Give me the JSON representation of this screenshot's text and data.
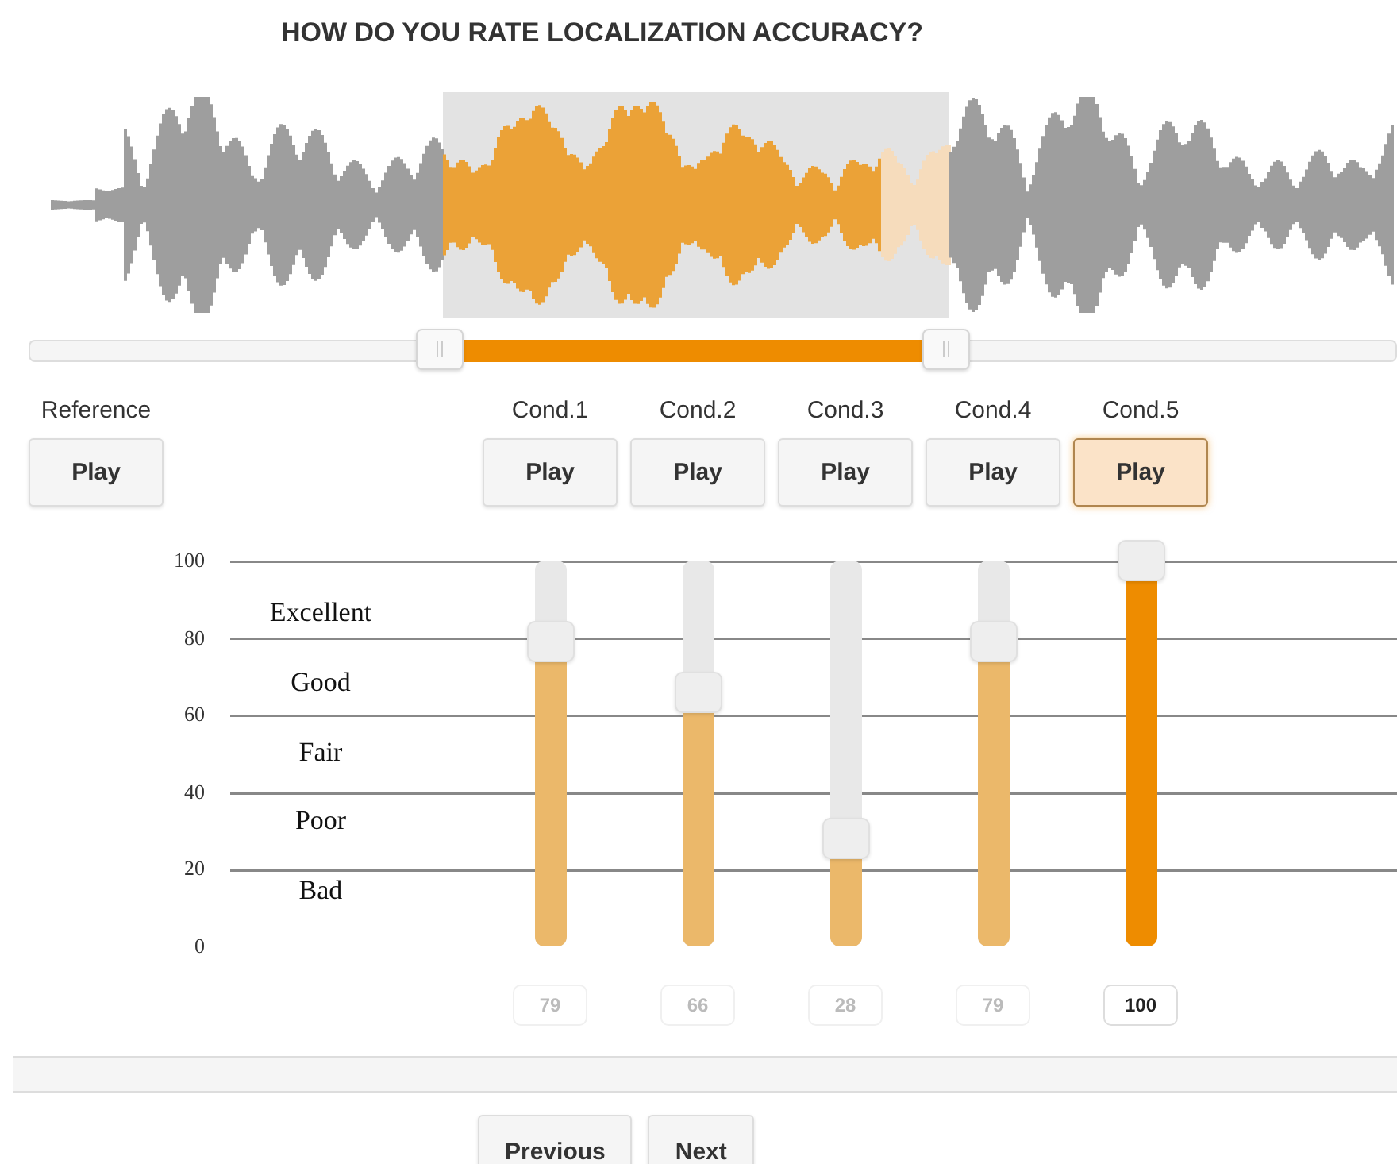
{
  "title": "HOW DO YOU RATE LOCALIZATION ACCURACY?",
  "reference": {
    "label": "Reference",
    "button": "Play"
  },
  "conditions": [
    {
      "label": "Cond.1",
      "button": "Play",
      "selected": false,
      "level": 0.79,
      "value": "79"
    },
    {
      "label": "Cond.2",
      "button": "Play",
      "selected": false,
      "level": 0.66,
      "value": "66"
    },
    {
      "label": "Cond.3",
      "button": "Play",
      "selected": false,
      "level": 0.28,
      "value": "28"
    },
    {
      "label": "Cond.4",
      "button": "Play",
      "selected": false,
      "level": 0.79,
      "value": "79"
    },
    {
      "label": "Cond.5",
      "button": "Play",
      "selected": true,
      "level": 1,
      "value": "100"
    }
  ],
  "scale": {
    "ticks": [
      "100",
      "80",
      "60",
      "40",
      "20",
      "0"
    ],
    "categories": [
      "Excellent",
      "Good",
      "Fair",
      "Poor",
      "Bad"
    ]
  },
  "progress": {
    "level": 0
  },
  "navigation": [
    "Previous",
    "Next"
  ]
}
